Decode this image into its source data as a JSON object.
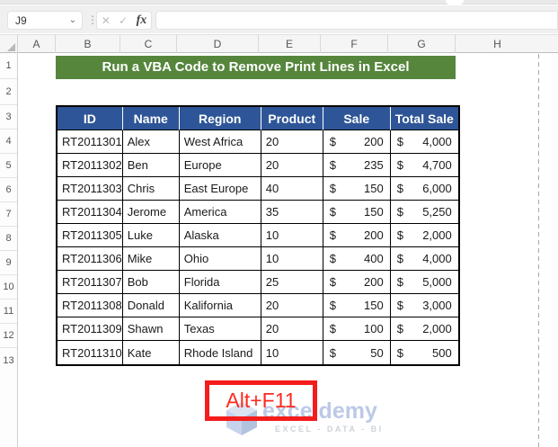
{
  "formula_bar": {
    "name_box_value": "J9",
    "formula_value": "",
    "icons": {
      "chevron": "⌄",
      "dots": "⋮",
      "cancel": "✕",
      "check": "✓",
      "fx": "fx"
    }
  },
  "column_headers": [
    "A",
    "B",
    "C",
    "D",
    "E",
    "F",
    "G",
    "H"
  ],
  "row_headers": [
    "1",
    "2",
    "3",
    "4",
    "5",
    "6",
    "7",
    "8",
    "9",
    "10",
    "11",
    "12",
    "13"
  ],
  "banner": {
    "text": "Run a VBA Code to Remove Print Lines in Excel",
    "bg": "#55863c"
  },
  "table": {
    "header_bg": "#2e5597",
    "currency": "$",
    "headers": [
      "ID",
      "Name",
      "Region",
      "Product",
      "Sale",
      "Total Sale"
    ],
    "rows": [
      {
        "id": "RT2011301",
        "name": "Alex",
        "region": "West Africa",
        "product": "20",
        "sale": "200",
        "total": "4,000"
      },
      {
        "id": "RT2011302",
        "name": "Ben",
        "region": "Europe",
        "product": "20",
        "sale": "235",
        "total": "4,700"
      },
      {
        "id": "RT2011303",
        "name": "Chris",
        "region": "East Europe",
        "product": "40",
        "sale": "150",
        "total": "6,000"
      },
      {
        "id": "RT2011304",
        "name": "Jerome",
        "region": "America",
        "product": "35",
        "sale": "150",
        "total": "5,250"
      },
      {
        "id": "RT2011305",
        "name": "Luke",
        "region": "Alaska",
        "product": "10",
        "sale": "200",
        "total": "2,000"
      },
      {
        "id": "RT2011306",
        "name": "Mike",
        "region": "Ohio",
        "product": "10",
        "sale": "400",
        "total": "4,000"
      },
      {
        "id": "RT2011307",
        "name": "Bob",
        "region": "Florida",
        "product": "25",
        "sale": "200",
        "total": "5,000"
      },
      {
        "id": "RT2011308",
        "name": "Donald",
        "region": "Kalifornia",
        "product": "20",
        "sale": "150",
        "total": "3,000"
      },
      {
        "id": "RT2011309",
        "name": "Shawn",
        "region": "Texas",
        "product": "20",
        "sale": "100",
        "total": "2,000"
      },
      {
        "id": "RT2011310",
        "name": "Kate",
        "region": "Rhode Island",
        "product": "10",
        "sale": "50",
        "total": "500"
      }
    ]
  },
  "callout": {
    "text": "Alt+F11",
    "color": "#f41c1c"
  },
  "watermark": {
    "brand": "exceldemy",
    "tagline": "EXCEL - DATA - BI",
    "color": "#b9c7e6"
  },
  "print_line_color": "#a6a6a6"
}
